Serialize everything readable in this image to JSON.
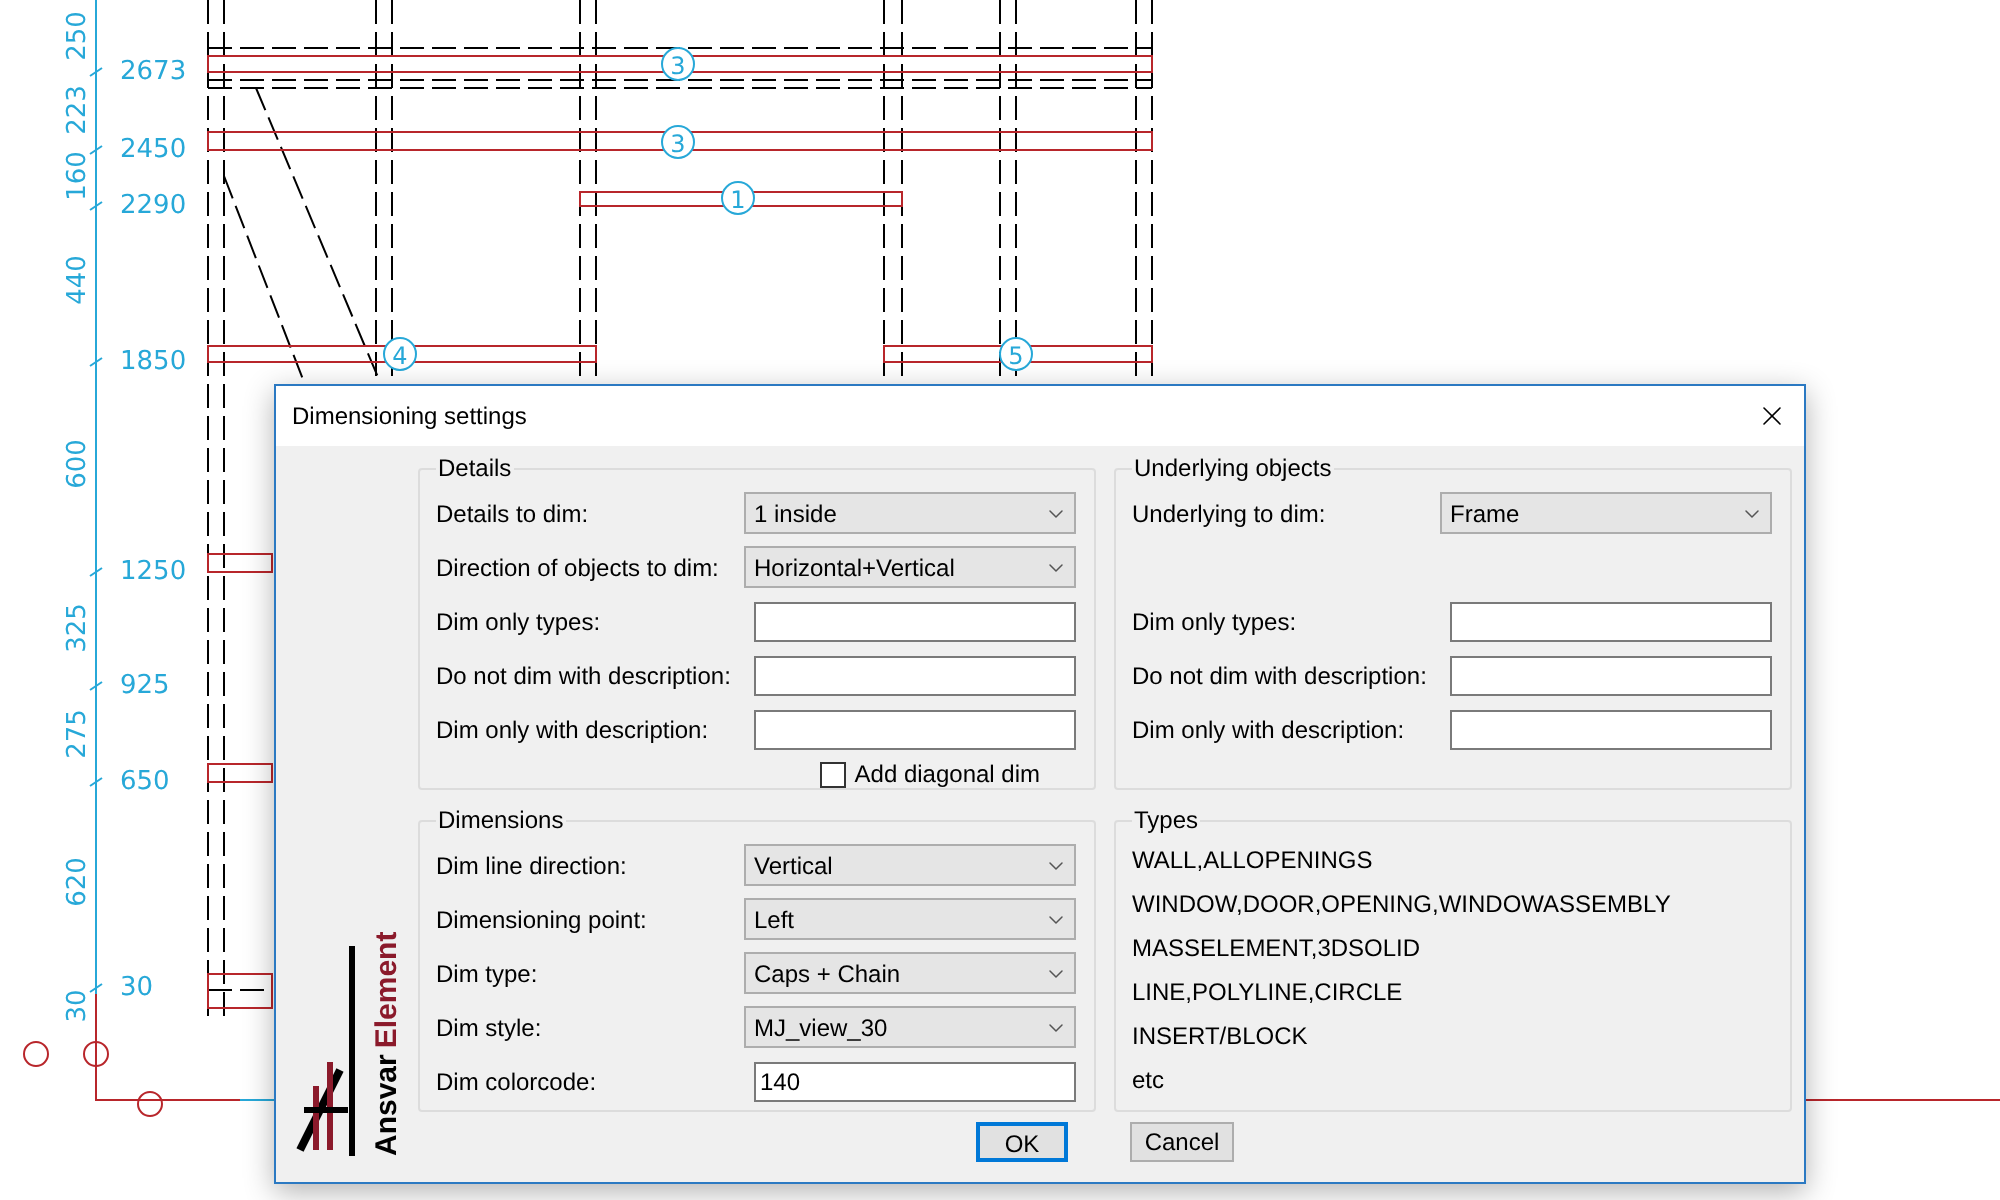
{
  "drawing": {
    "level_labels": [
      "2673",
      "2450",
      "2290",
      "1850",
      "1250",
      "925",
      "650",
      "30"
    ],
    "segment_labels": [
      "250",
      "223",
      "160",
      "440",
      "600",
      "325",
      "275",
      "620",
      "30"
    ],
    "callouts": [
      "3",
      "3",
      "1",
      "4",
      "5"
    ]
  },
  "dialog": {
    "title": "Dimensioning settings",
    "logo": {
      "brand": "Ansvar",
      "product": "Element"
    },
    "details": {
      "title": "Details",
      "rows": [
        {
          "kind": "select",
          "label": "Details to dim:",
          "value": "1 inside"
        },
        {
          "kind": "select",
          "label": "Direction of objects to dim:",
          "value": "Horizontal+Vertical"
        },
        {
          "kind": "text",
          "label": "Dim only types:"
        },
        {
          "kind": "text",
          "label": "Do not dim with description:"
        },
        {
          "kind": "text",
          "label": "Dim only with description:"
        }
      ],
      "checkbox": {
        "label": "Add diagonal dim",
        "checked": false
      }
    },
    "underlying": {
      "title": "Underlying objects",
      "rows": [
        {
          "kind": "select",
          "label": "Underlying to dim:",
          "value": "Frame"
        },
        {
          "kind": "text",
          "label": "Dim only types:"
        },
        {
          "kind": "text",
          "label": "Do not dim with description:"
        },
        {
          "kind": "text",
          "label": "Dim only with description:"
        }
      ]
    },
    "dimensions": {
      "title": "Dimensions",
      "rows": [
        {
          "kind": "select",
          "label": "Dim line direction:",
          "value": "Vertical"
        },
        {
          "kind": "select",
          "label": "Dimensioning point:",
          "value": "Left"
        },
        {
          "kind": "select",
          "label": "Dim type:",
          "value": "Caps + Chain"
        },
        {
          "kind": "select",
          "label": "Dim style:",
          "value": "MJ_view_30"
        },
        {
          "kind": "text",
          "label": "Dim colorcode:",
          "value": "140"
        }
      ]
    },
    "types": {
      "title": "Types",
      "items": [
        "WALL,ALLOPENINGS",
        "WINDOW,DOOR,OPENING,WINDOWASSEMBLY",
        "MASSELEMENT,3DSOLID",
        "LINE,POLYLINE,CIRCLE",
        "INSERT/BLOCK",
        "etc"
      ]
    },
    "buttons": [
      "OK",
      "Cancel"
    ]
  }
}
